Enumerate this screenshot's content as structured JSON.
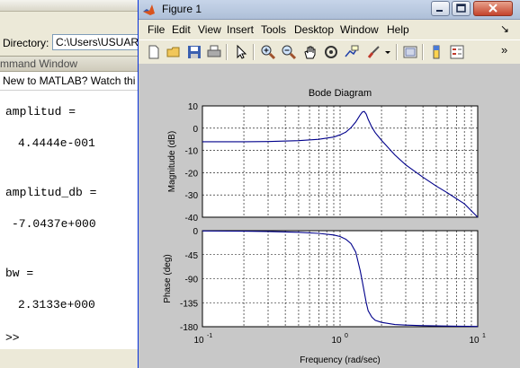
{
  "desktop": {
    "directory_label": "Directory:",
    "directory_path": "C:\\Users\\USUARI",
    "command_window_title": "mmand Window",
    "banner": "New to MATLAB? Watch thi",
    "lines": [
      "amplitud =",
      "4.4444e-001",
      "amplitud_db =",
      "-7.0437e+000",
      "bw =",
      "2.3133e+000",
      ">>"
    ]
  },
  "figure": {
    "title": "Figure 1",
    "menu": [
      "File",
      "Edit",
      "View",
      "Insert",
      "Tools",
      "Desktop",
      "Window",
      "Help"
    ],
    "menu_arrow": "↘",
    "toolbar_icons": [
      "new-file-icon",
      "open-folder-icon",
      "save-icon",
      "print-icon",
      "pointer-icon",
      "zoom-in-icon",
      "zoom-out-icon",
      "pan-hand-icon",
      "rotate-3d-icon",
      "data-cursor-icon",
      "brush-icon",
      "link-plot-icon",
      "colorbar-icon",
      "legend-icon"
    ],
    "toolbar_overflow": "»"
  },
  "chart_data": {
    "type": "line",
    "title": "Bode Diagram",
    "xlabel": "Frequency  (rad/sec)",
    "x_scale": "log",
    "xlim": [
      0.1,
      10
    ],
    "x_ticks": [
      "10",
      "10",
      "10"
    ],
    "x_tick_exponents": [
      "-1",
      "0",
      "1"
    ],
    "grid": true,
    "color": "#00008b",
    "magnitude": {
      "ylabel": "Magnitude (dB)",
      "ylim": [
        -40,
        10
      ],
      "y_ticks": [
        "10",
        "0",
        "-10",
        "-20",
        "-30",
        "-40"
      ],
      "x": [
        0.1,
        0.2,
        0.3,
        0.5,
        0.7,
        0.9,
        1.0,
        1.1,
        1.2,
        1.3,
        1.4,
        1.45,
        1.5,
        1.55,
        1.6,
        1.7,
        1.8,
        2.0,
        2.5,
        3,
        4,
        5,
        6,
        8,
        10
      ],
      "y": [
        -6.1,
        -6.1,
        -6.0,
        -5.6,
        -5.0,
        -4.0,
        -3.0,
        -1.8,
        0.2,
        2.8,
        6.0,
        7.2,
        7.5,
        6.3,
        4.0,
        0.5,
        -2.0,
        -5.5,
        -12,
        -16.5,
        -22,
        -26,
        -29,
        -34,
        -40
      ]
    },
    "phase": {
      "ylabel": "Phase (deg)",
      "ylim": [
        -180,
        0
      ],
      "y_ticks": [
        "0",
        "-45",
        "-90",
        "-135",
        "-180"
      ],
      "x": [
        0.1,
        0.2,
        0.3,
        0.5,
        0.7,
        0.9,
        1.0,
        1.1,
        1.2,
        1.3,
        1.4,
        1.45,
        1.5,
        1.55,
        1.6,
        1.7,
        1.8,
        2.0,
        2.5,
        3,
        4,
        5,
        7,
        10
      ],
      "y": [
        -0.5,
        -1,
        -1.5,
        -3,
        -5,
        -8,
        -11,
        -16,
        -24,
        -40,
        -75,
        -95,
        -115,
        -135,
        -150,
        -162,
        -168,
        -172,
        -176,
        -177,
        -178,
        -178.5,
        -179,
        -179.5
      ]
    }
  }
}
